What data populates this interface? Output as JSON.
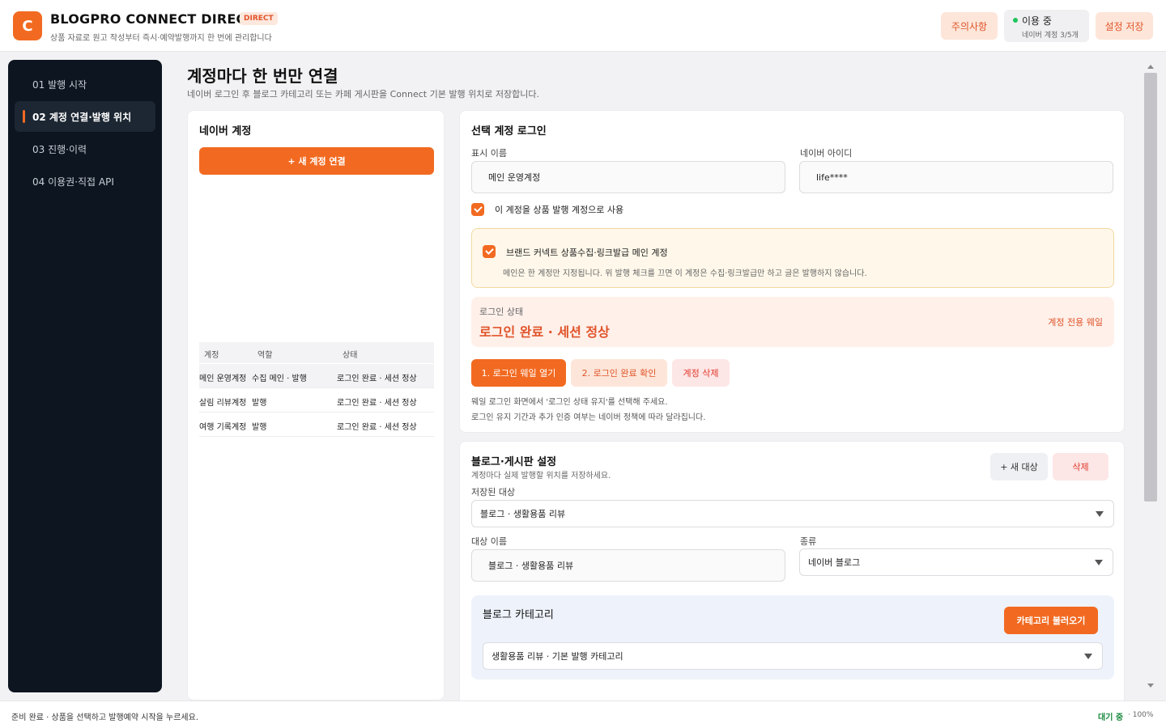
{
  "header": {
    "logo_letter": "C",
    "title": "BLOGPRO CONNECT DIRECT",
    "badge": "DIRECT",
    "subtitle": "상품 자료로 원고 작성부터 즉시·예약발행까지 한 번에 관리합니다",
    "notice_button": "주의사항",
    "status_label": "이용 중",
    "status_count": "네이버 계정 3/5개",
    "save_button": "설정 저장"
  },
  "sidebar": {
    "items": [
      {
        "label": "01  발행 시작"
      },
      {
        "label": "02  계정 연결·발행 위치"
      },
      {
        "label": "03  진행·이력"
      },
      {
        "label": "04  이용권·직접 API"
      }
    ]
  },
  "main": {
    "title": "계정마다 한 번만 연결",
    "subtitle": "네이버 로그인 후 블로그 카테고리 또는 카페 게시판을 Connect 기본 발행 위치로 저장합니다."
  },
  "accounts": {
    "title": "네이버 계정",
    "add_button": "+ 새 계정 연결",
    "columns": [
      "계정",
      "역할",
      "상태"
    ],
    "rows": [
      {
        "account": "메인 운영계정",
        "role": "수집 메인 · 발행",
        "status": "로그인 완료 · 세션 정상"
      },
      {
        "account": "살림 리뷰계정",
        "role": "발행",
        "status": "로그인 완료 · 세션 정상"
      },
      {
        "account": "여행 기록계정",
        "role": "발행",
        "status": "로그인 완료 · 세션 정상"
      }
    ]
  },
  "login": {
    "title": "선택 계정 로그인",
    "display_name_label": "표시 이름",
    "display_name_value": "메인 운영계정",
    "naver_id_label": "네이버 아이디",
    "naver_id_value": "life****",
    "use_publish_label": "이 계정을 상품 발행 계정으로 사용",
    "brand_title": "브랜드 커넥트 상품수집·링크발급 메인 계정",
    "brand_desc": "메인은 한 계정만 지정됩니다. 위 발행 체크를 끄면 이 계정은 수집·링크발급만 하고 글은 발행하지 않습니다.",
    "status_label": "로그인 상태",
    "status_value": "로그인 완료 · 세션 정상",
    "status_link": "계정 전용 웨일",
    "btn_open": "1. 로그인 웨일 열기",
    "btn_confirm": "2. 로그인 완료 확인",
    "btn_delete": "계정 삭제",
    "hint1": "웨일 로그인 화면에서 '로그인 상태 유지'를 선택해 주세요.",
    "hint2": "로그인 유지 기간과 추가 인증 여부는 네이버 정책에 따라 달라집니다."
  },
  "blog": {
    "title": "블로그·게시판 설정",
    "subtitle": "계정마다 실제 발행할 위치를 저장하세요.",
    "add_button": "+ 새 대상",
    "delete_button": "삭제",
    "saved_label": "저장된 대상",
    "saved_value": "블로그 · 생활용품 리뷰",
    "target_name_label": "대상 이름",
    "target_name_value": "블로그 · 생활용품 리뷰",
    "kind_label": "종류",
    "kind_value": "네이버 블로그",
    "category_title": "블로그 카테고리",
    "category_button": "카테고리 불러오기",
    "category_value": "생활용품 리뷰  ·  기본 발행 카테고리"
  },
  "footer": {
    "message": "준비 완료 · 상품을 선택하고 발행예약 시작을 누르세요.",
    "state": "대기 중",
    "zoom": "· 100%"
  },
  "colors": {
    "accent": "#f26a21",
    "sidebar_bg": "#0c1520",
    "success": "#1ec45c"
  }
}
